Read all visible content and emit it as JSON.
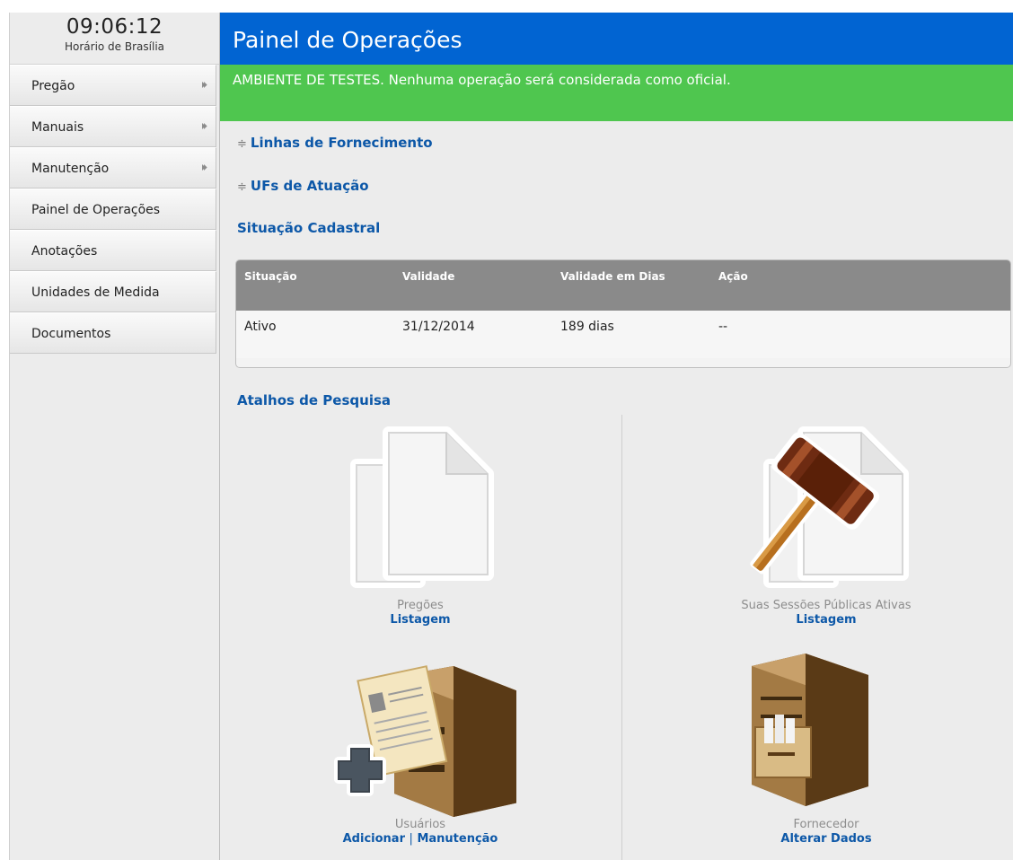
{
  "clock": {
    "time": "09:06:12",
    "timezone": "Horário de Brasília"
  },
  "menu": [
    {
      "label": "Pregão",
      "has_submenu": true
    },
    {
      "label": "Manuais",
      "has_submenu": true
    },
    {
      "label": "Manutenção",
      "has_submenu": true
    },
    {
      "label": "Painel de Operações",
      "has_submenu": false
    },
    {
      "label": "Anotações",
      "has_submenu": false
    },
    {
      "label": "Unidades de Medida",
      "has_submenu": false
    },
    {
      "label": "Documentos",
      "has_submenu": false
    }
  ],
  "menu_arrow_glyph": "⏵⏵",
  "header": {
    "title": "Painel de Operações"
  },
  "banner": {
    "text": "AMBIENTE DE TESTES. Nenhuma operação será considerada como oficial."
  },
  "sections": {
    "toggle_glyph": "≑",
    "linhas": "Linhas de Fornecimento",
    "ufs": "UFs de Atuação",
    "situacao": "Situação Cadastral",
    "atalhos": "Atalhos de Pesquisa"
  },
  "status_table": {
    "headers": [
      "Situação",
      "Validade",
      "Validade em Dias",
      "Ação"
    ],
    "rows": [
      [
        "Ativo",
        "31/12/2014",
        "189 dias",
        "--"
      ]
    ]
  },
  "shortcuts": {
    "pregoes": {
      "title": "Pregões",
      "link": "Listagem",
      "icon": "documents-icon"
    },
    "sessoes": {
      "title": "Suas Sessões Públicas Ativas",
      "link": "Listagem",
      "icon": "gavel-documents-icon"
    },
    "usuarios": {
      "title": "Usuários",
      "link_add": "Adicionar",
      "separator": "|",
      "link_manage": "Manutenção",
      "icon": "cabinet-add-icon"
    },
    "fornecedor": {
      "title": "Fornecedor",
      "link": "Alterar Dados",
      "icon": "cabinet-icon"
    }
  },
  "colors": {
    "header": "#0164d2",
    "banner": "#4fc64f",
    "link": "#0d58a8",
    "table_header": "#8a8a8a"
  }
}
